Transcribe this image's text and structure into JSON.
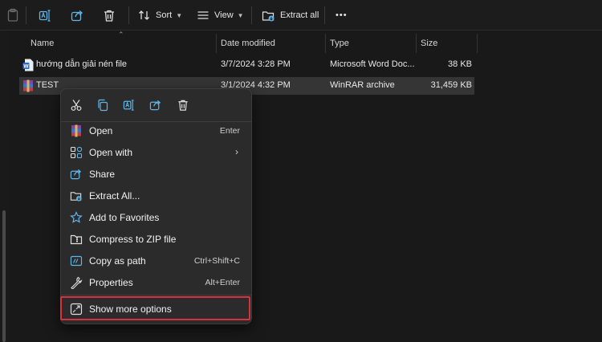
{
  "toolbar": {
    "sort_label": "Sort",
    "view_label": "View",
    "extract_label": "Extract all",
    "more_label": "•••"
  },
  "columns": {
    "name": "Name",
    "date": "Date modified",
    "type": "Type",
    "size": "Size"
  },
  "files": [
    {
      "name": "hướng dẫn giải nén file",
      "date": "3/7/2024 3:28 PM",
      "type": "Microsoft Word Doc...",
      "size": "38 KB",
      "icon": "word-doc-icon",
      "selected": false
    },
    {
      "name": "TEST",
      "date": "3/1/2024 4:32 PM",
      "type": "WinRAR archive",
      "size": "31,459 KB",
      "icon": "winrar-icon",
      "selected": true
    }
  ],
  "context_menu": {
    "quick_actions": [
      "cut-icon",
      "copy-icon",
      "rename-icon",
      "share-icon",
      "delete-icon"
    ],
    "items": [
      {
        "label": "Open",
        "shortcut": "Enter",
        "icon": "winrar-icon"
      },
      {
        "label": "Open with",
        "shortcut": "",
        "icon": "open-with-icon",
        "submenu": "›"
      },
      {
        "label": "Share",
        "shortcut": "",
        "icon": "share-icon"
      },
      {
        "label": "Extract All...",
        "shortcut": "",
        "icon": "extract-icon"
      },
      {
        "label": "Add to Favorites",
        "shortcut": "",
        "icon": "star-icon"
      },
      {
        "label": "Compress to ZIP file",
        "shortcut": "",
        "icon": "zip-folder-icon"
      },
      {
        "label": "Copy as path",
        "shortcut": "Ctrl+Shift+C",
        "icon": "copy-path-icon"
      },
      {
        "label": "Properties",
        "shortcut": "Alt+Enter",
        "icon": "wrench-icon"
      }
    ],
    "more_options": {
      "label": "Show more options",
      "icon": "show-more-options-icon"
    }
  },
  "colors": {
    "background": "#191919",
    "menu_background": "#2b2b2b",
    "selected_row": "#353535",
    "highlight_border": "#d8323f",
    "icon_blue": "#60b6e9"
  }
}
